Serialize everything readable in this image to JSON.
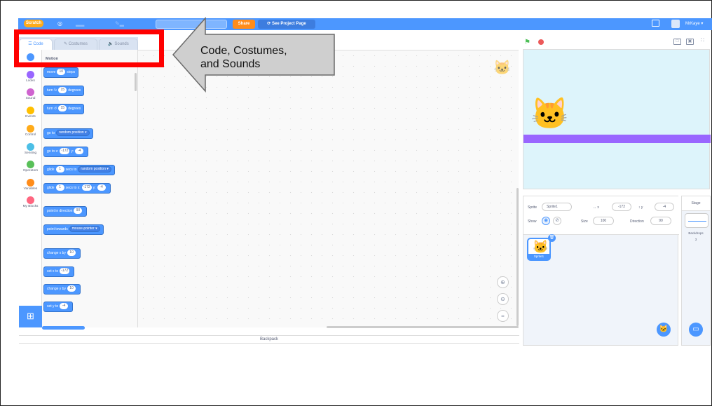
{
  "topbar": {
    "logo": "Scratch",
    "title_value": "",
    "share": "Share",
    "project_page": "See Project Page",
    "username": "MrKaye"
  },
  "tabs": [
    {
      "label": "Code",
      "icon": "code-icon"
    },
    {
      "label": "Costumes",
      "icon": "brush-icon"
    },
    {
      "label": "Sounds",
      "icon": "speaker-icon"
    }
  ],
  "categories": [
    {
      "label": "Motion",
      "color": "#4c97ff"
    },
    {
      "label": "Looks",
      "color": "#9966ff"
    },
    {
      "label": "Sound",
      "color": "#cf63cf"
    },
    {
      "label": "Events",
      "color": "#ffbf00"
    },
    {
      "label": "Control",
      "color": "#ffab19"
    },
    {
      "label": "Sensing",
      "color": "#4cbfe6"
    },
    {
      "label": "Operators",
      "color": "#59c059"
    },
    {
      "label": "Variables",
      "color": "#ff8c1a"
    },
    {
      "label": "My Blocks",
      "color": "#ff6680"
    }
  ],
  "palette": {
    "heading": "Motion",
    "blocks": [
      {
        "text_a": "move",
        "value": "10",
        "text_b": "steps"
      },
      {
        "text_a": "turn",
        "value": "15",
        "text_b": "degrees"
      },
      {
        "text_a": "turn",
        "value": "15",
        "text_b": "degrees"
      },
      {
        "text_a": "go to",
        "dropdown": "random position ▾"
      },
      {
        "text_a": "go to x:",
        "value": "-172",
        "text_b": "y:",
        "value2": "-4"
      },
      {
        "text_a": "glide",
        "value": "1",
        "text_b": "secs to",
        "dropdown": "random position ▾"
      },
      {
        "text_a": "glide",
        "value": "1",
        "text_b": "secs to x:",
        "value2": "-172",
        "text_c": "y:",
        "value3": "-4"
      },
      {
        "text_a": "point in direction",
        "value": "90"
      },
      {
        "text_a": "point towards",
        "dropdown": "mouse-pointer ▾"
      },
      {
        "text_a": "change x by",
        "value": "10"
      },
      {
        "text_a": "set x to",
        "value": "-172"
      },
      {
        "text_a": "change y by",
        "value": "10"
      },
      {
        "text_a": "set y to",
        "value": "-4"
      }
    ]
  },
  "callout": {
    "line1": "Code, Costumes,",
    "line2": "and Sounds"
  },
  "backpack": "Backpack",
  "sprite_info": {
    "sprite_label": "Sprite",
    "sprite_name": "Sprite1",
    "x_label": "x",
    "x_value": "-172",
    "y_label": "y",
    "y_value": "-4",
    "show_label": "Show",
    "size_label": "Size",
    "size_value": "100",
    "direction_label": "Direction",
    "direction_value": "90"
  },
  "sprite_tile": "Sprite1",
  "stage_pane": {
    "title": "Stage",
    "backdrops_label": "Backdrops",
    "backdrops_count": "3"
  },
  "colors": {
    "accent": "#4c97ff",
    "highlight": "#ff0000",
    "stage_ground": "#9966ff"
  }
}
